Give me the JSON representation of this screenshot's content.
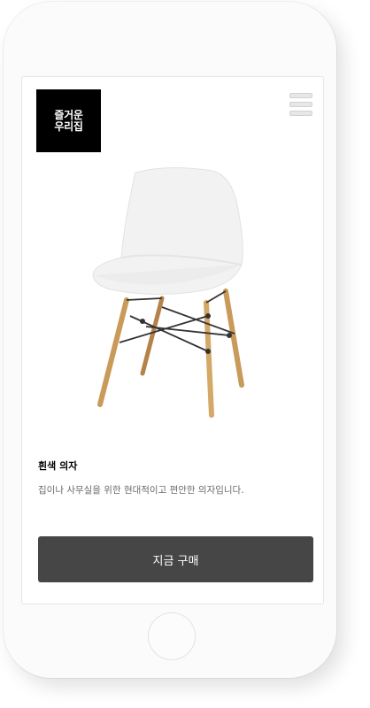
{
  "brand": {
    "logo_text": "즐거운\n우리집"
  },
  "header": {
    "menu_icon": "hamburger-menu-icon"
  },
  "product": {
    "name": "흰색 의자",
    "description": "집이나 사무실을 위한 현대적이고 편안한 의자입니다.",
    "image": "white-chair-image"
  },
  "actions": {
    "buy_label": "지금 구매"
  },
  "colors": {
    "button_bg": "#464646",
    "logo_bg": "#000000",
    "title_text": "#000000",
    "description_text": "#6a6a6a"
  }
}
